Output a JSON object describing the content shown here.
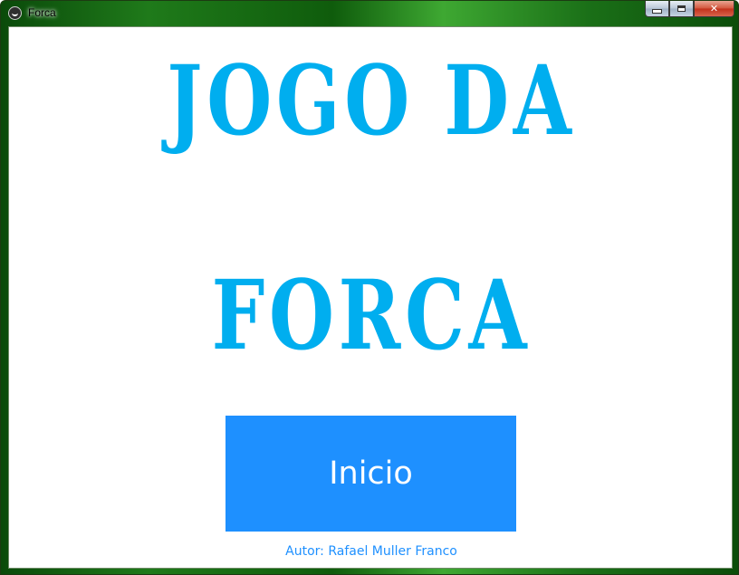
{
  "window": {
    "title": "Forca",
    "app_icon": "kivy-icon",
    "controls": {
      "minimize_icon": "minimize-icon",
      "maximize_icon": "maximize-icon",
      "close_icon": "close-icon",
      "close_glyph": "✕"
    }
  },
  "main": {
    "title_line1": "JOGO DA",
    "title_line2": "FORCA",
    "start_button_label": "Inicio",
    "author": "Autor: Rafael Muller Franco"
  },
  "colors": {
    "title": "#00aeef",
    "button": "#1e90ff",
    "button_text": "#ffffff",
    "author_text": "#1e90ff"
  }
}
